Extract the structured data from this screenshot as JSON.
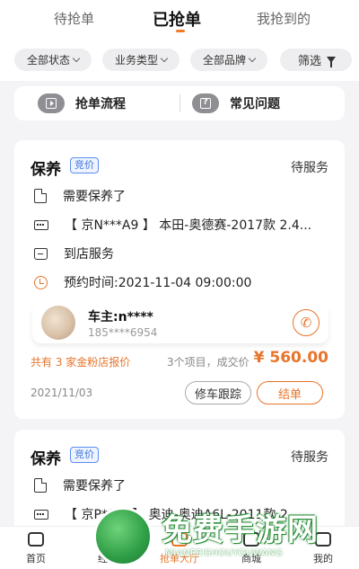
{
  "tabs": [
    {
      "label": "待抢单",
      "active": false
    },
    {
      "label": "已抢单",
      "active": true
    },
    {
      "label": "我抢到的",
      "active": false
    }
  ],
  "filters": {
    "chips": [
      "全部状态",
      "业务类型",
      "全部品牌"
    ],
    "filter_label": "筛选"
  },
  "quick_links": {
    "process": "抢单流程",
    "faq": "常见问题"
  },
  "order1": {
    "type": "保养",
    "badge": "竞价",
    "status": "待服务",
    "need": "需要保养了",
    "vehicle": "【 京N***A9 】 本田-奥德赛-2017款 2.4...",
    "service": "到店服务",
    "appointment": "预约时间:2021-11-04 09:00:00",
    "owner_name": "车主:n****",
    "owner_phone": "185****6954",
    "quote_info": "共有 3 家金粉店报价",
    "summary": "3个项目，成交价",
    "price": "¥ 560.00",
    "date": "2021/11/03",
    "track_label": "修车跟踪",
    "finish_label": "结单"
  },
  "order2": {
    "type": "保养",
    "badge": "竞价",
    "status": "待服务",
    "need": "需要保养了",
    "vehicle": "【 京P***E 】 奥迪-奥迪A6L-2011款 2..."
  },
  "bottom_nav": [
    {
      "label": "首页",
      "active": false
    },
    {
      "label": "经营",
      "active": false
    },
    {
      "label": "抢单大厅",
      "active": true
    },
    {
      "label": "商城",
      "active": false
    },
    {
      "label": "我的",
      "active": false
    }
  ],
  "watermark": {
    "title": "免费手游网",
    "subtitle": "MIANFEISHOUYOUWANG"
  },
  "colors": {
    "accent": "#e8742a",
    "badge_blue": "#3f73d8",
    "watermark_green": "#2e9e46"
  },
  "icons": [
    "document-icon",
    "plate-icon",
    "shop-icon",
    "clock-icon",
    "phone-icon",
    "funnel-icon",
    "chevron-down-icon"
  ]
}
